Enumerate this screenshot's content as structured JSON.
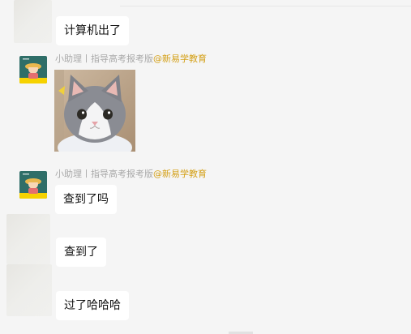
{
  "messages": {
    "msg1": "计算机出了",
    "msg2": "查到了吗",
    "msg3": "查到了",
    "msg4": "过了哈哈哈"
  },
  "sender": {
    "name": "小助理丨指导高考报考版",
    "org": "@新易学教育"
  },
  "colors": {
    "background": "#f5f5f5",
    "bubble": "#ffffff",
    "sender_name": "#a9a9a9",
    "sender_org": "#d4a017"
  },
  "icons": {
    "avatar": "cartoon-girl-avatar",
    "sticker": "grey-cat-photo"
  }
}
